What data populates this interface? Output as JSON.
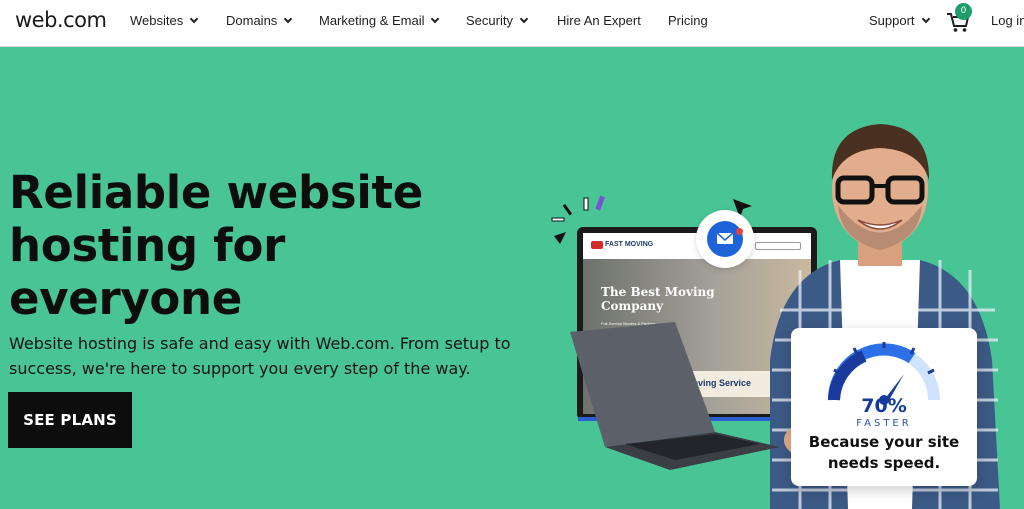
{
  "header": {
    "logo": "web.com",
    "nav": [
      {
        "label": "Websites",
        "dropdown": true
      },
      {
        "label": "Domains",
        "dropdown": true
      },
      {
        "label": "Marketing & Email",
        "dropdown": true
      },
      {
        "label": "Security",
        "dropdown": true
      },
      {
        "label": "Hire An Expert",
        "dropdown": false
      },
      {
        "label": "Pricing",
        "dropdown": false
      }
    ],
    "support": "Support",
    "cart_count": "0",
    "login": "Log in",
    "icons": [
      "chevron-down-icon",
      "cart-icon"
    ]
  },
  "hero": {
    "headline": "Reliable website hosting for everyone",
    "subtext": "Website hosting is safe and easy with Web.com. From setup to success, we're here to support you every step of the way.",
    "cta": "SEE PLANS"
  },
  "illustration": {
    "screen": {
      "logo": "FAST MOVING",
      "title": "The Best Moving Company",
      "subtitle": "Full-Service Movers & Packers",
      "box_text": "Moving Service"
    },
    "badge": {
      "percent": "70%",
      "faster": "FASTER",
      "tagline": "Because your site needs speed."
    },
    "icons": [
      "email-icon",
      "cursor-icon",
      "gauge-icon"
    ]
  },
  "colors": {
    "hero_bg": "#48c495",
    "nav_bg": "#ffffff",
    "cta_bg": "#0d0d0d",
    "badge_blue": "#123a9c",
    "cart_badge": "#1e9c6a"
  }
}
